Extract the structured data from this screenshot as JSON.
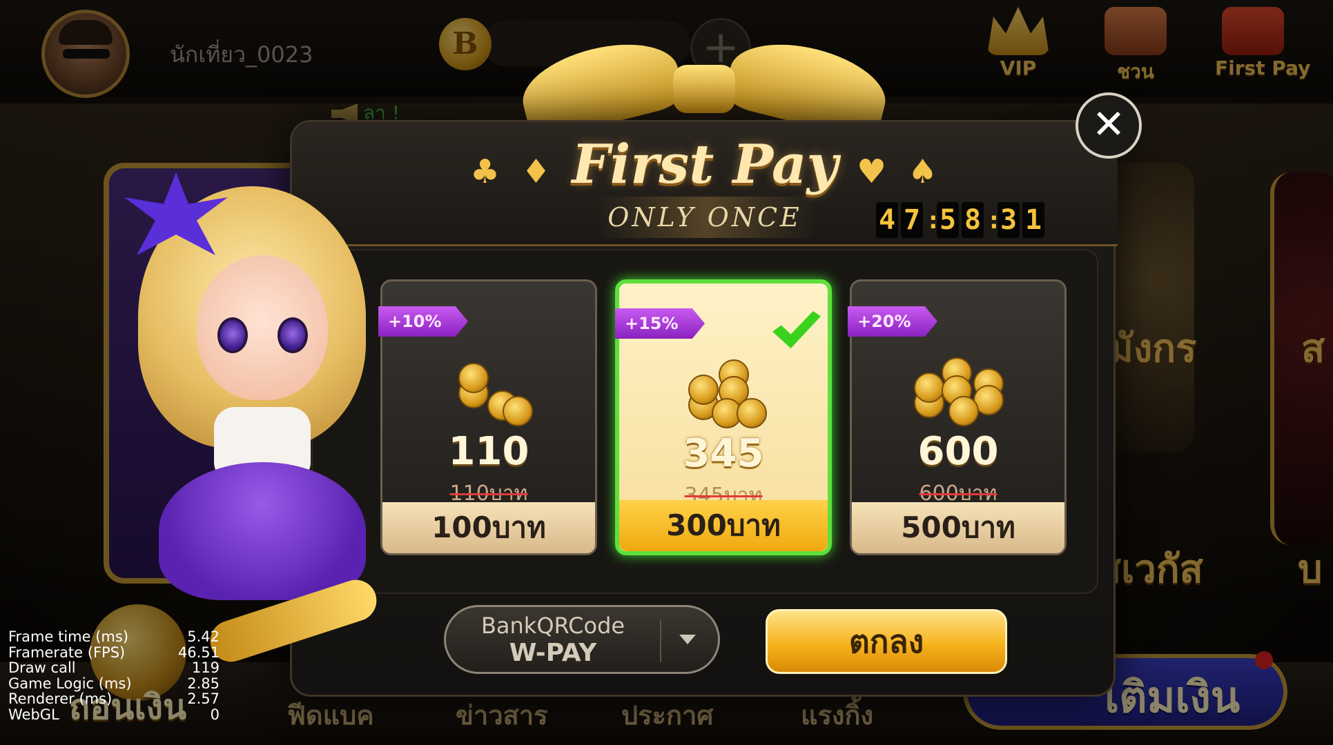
{
  "topbar": {
    "username": "นักเที่ยว_0023",
    "coin_symbol": "B",
    "add_symbol": "+",
    "vip_label": "VIP",
    "share_label": "ชวน",
    "first_pay_label": "First Pay"
  },
  "announcement": "ลา !",
  "lobby": {
    "side_label_1": "มังกร",
    "side_label_2": "สเวกัส",
    "side_label_3": "บ",
    "side_label_4": "ส"
  },
  "bottom_nav": {
    "withdraw_label": "ถอนเงิน",
    "items": [
      "ฟีดแบค",
      "ข่าวสาร",
      "ประกาศ",
      "แรงกิ้ง"
    ],
    "deposit_label": "เติมเงิน"
  },
  "modal": {
    "title": "First Pay",
    "subtitle": "ONLY ONCE",
    "countdown": {
      "hours": [
        "4",
        "7"
      ],
      "minutes": [
        "5",
        "8"
      ],
      "seconds": [
        "3",
        "1"
      ]
    },
    "packs": [
      {
        "bonus": "+10%",
        "amount": "110",
        "original": "110บาท",
        "price": "100บาท",
        "selected": false
      },
      {
        "bonus": "+15%",
        "amount": "345",
        "original": "345บาท",
        "price": "300บาท",
        "selected": true
      },
      {
        "bonus": "+20%",
        "amount": "600",
        "original": "600บาท",
        "price": "500บาท",
        "selected": false
      }
    ],
    "payment": {
      "line1": "BankQRCode",
      "line2": "W-PAY"
    },
    "confirm_label": "ตกลง",
    "close_symbol": "✕",
    "suits": [
      "♣",
      "♦",
      "♥",
      "♠"
    ]
  },
  "stats": [
    {
      "label": "Frame time (ms)",
      "value": "5.42"
    },
    {
      "label": "Framerate (FPS)",
      "value": "46.51"
    },
    {
      "label": "Draw call",
      "value": "119"
    },
    {
      "label": "Game Logic (ms)",
      "value": "2.85"
    },
    {
      "label": "Renderer (ms)",
      "value": "2.57"
    },
    {
      "label": "WebGL",
      "value": "0"
    }
  ],
  "colors": {
    "accent": "#f5c33c",
    "selected": "#5ee03c",
    "bonus_badge": "#a03ad8"
  }
}
